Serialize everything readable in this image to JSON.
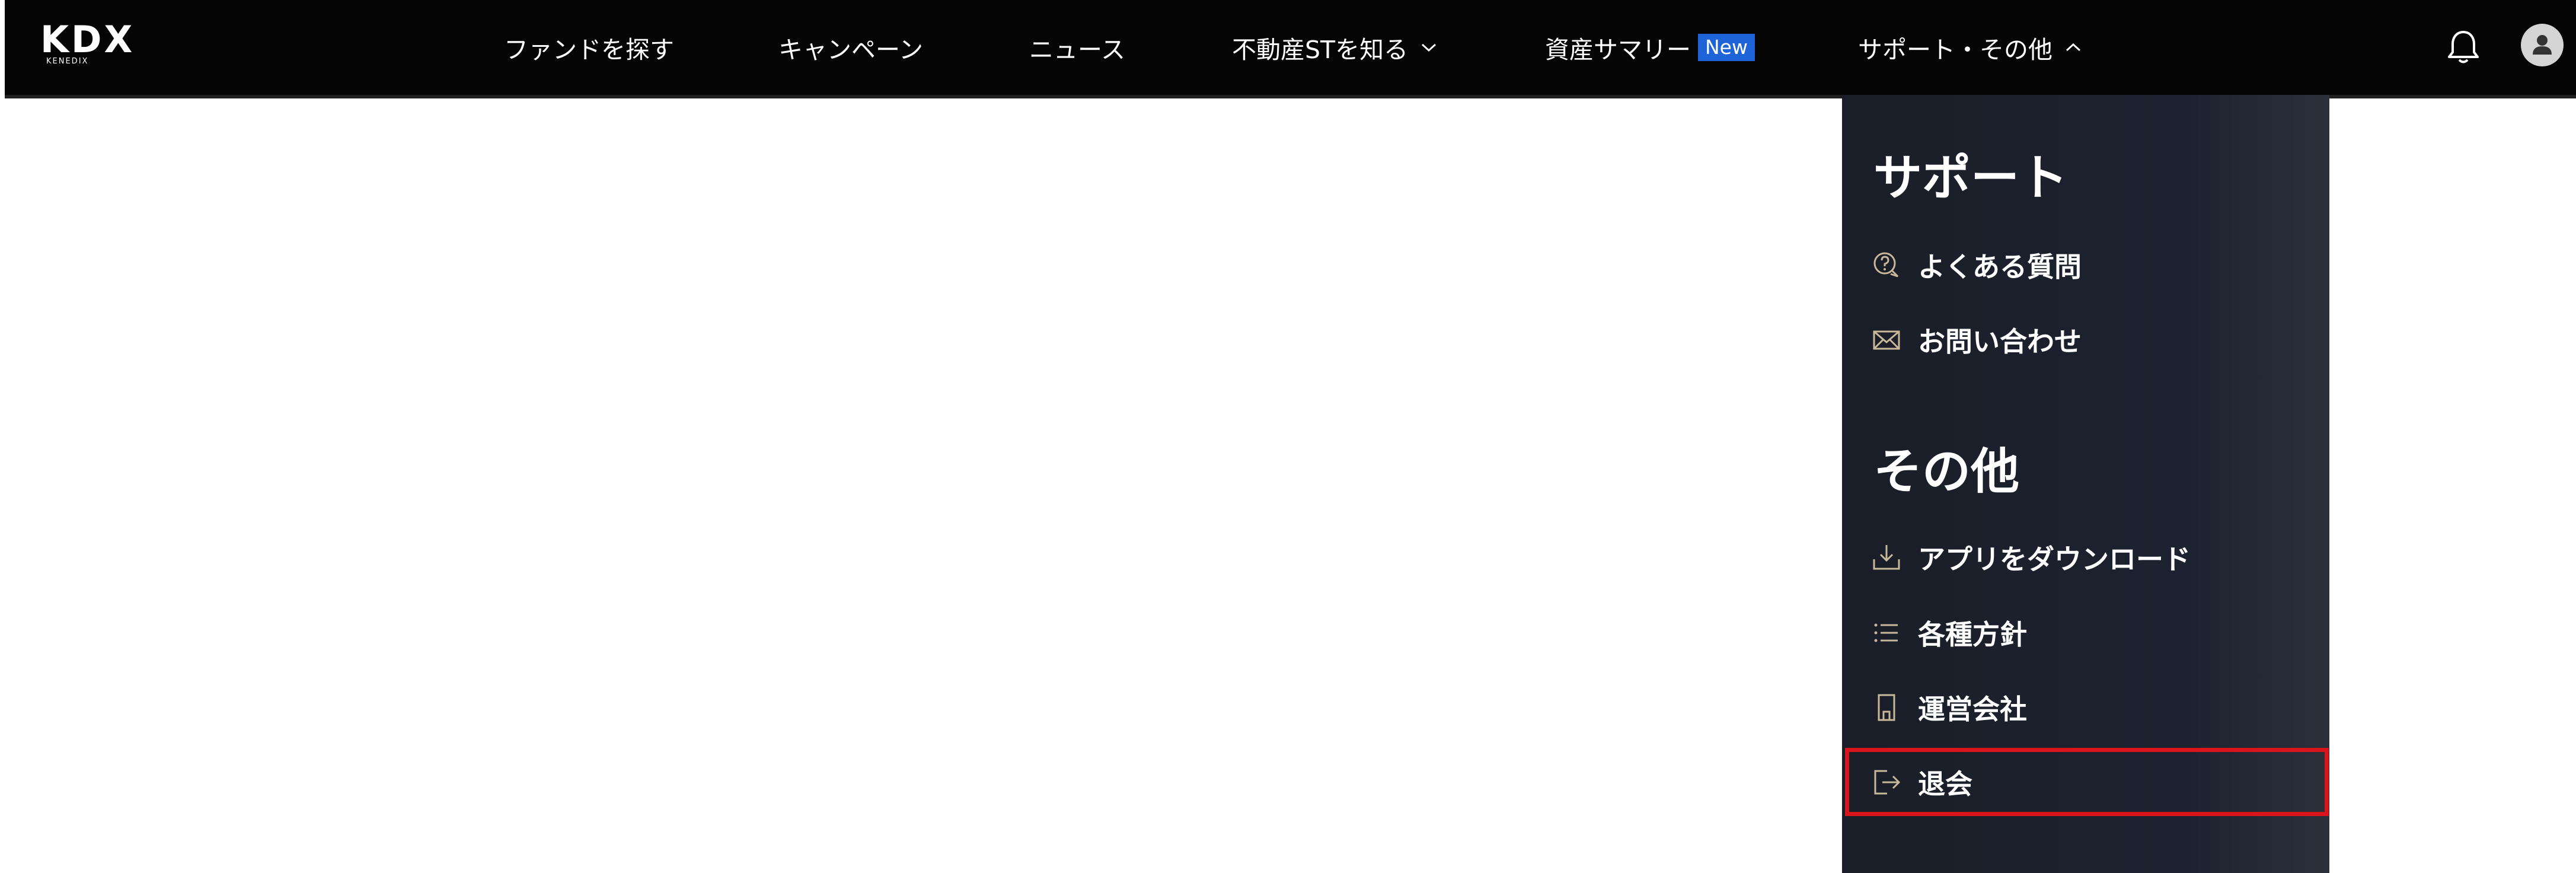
{
  "header": {
    "logo": {
      "main": "KDX",
      "sub": "KENEDIX"
    },
    "nav": [
      {
        "label": "ファンドを探す"
      },
      {
        "label": "キャンペーン"
      },
      {
        "label": "ニュース"
      },
      {
        "label": "不動産STを知る",
        "icon": "chevron-down-icon"
      },
      {
        "label": "資産サマリー",
        "badge": "New"
      },
      {
        "label": "サポート・その他",
        "icon": "chevron-up-icon"
      }
    ],
    "icons": [
      "bell-icon",
      "user-avatar-icon"
    ]
  },
  "dropdown": {
    "support_title": "サポート",
    "support_items": [
      {
        "label": "よくある質問",
        "icon": "faq-bubble-icon"
      },
      {
        "label": "お問い合わせ",
        "icon": "mail-icon"
      }
    ],
    "other_title": "その他",
    "other_items": [
      {
        "label": "アプリをダウンロード",
        "icon": "download-icon"
      },
      {
        "label": "各種方針",
        "icon": "list-icon"
      },
      {
        "label": "運営会社",
        "icon": "building-icon"
      },
      {
        "label": "退会",
        "icon": "logout-icon"
      }
    ]
  },
  "colors": {
    "header_bg": "#050505",
    "dropdown_bg": "#1d2230",
    "badge_bg": "#1f63d8",
    "icon_accent": "#c8b89a",
    "highlight_border": "#d9141a"
  }
}
